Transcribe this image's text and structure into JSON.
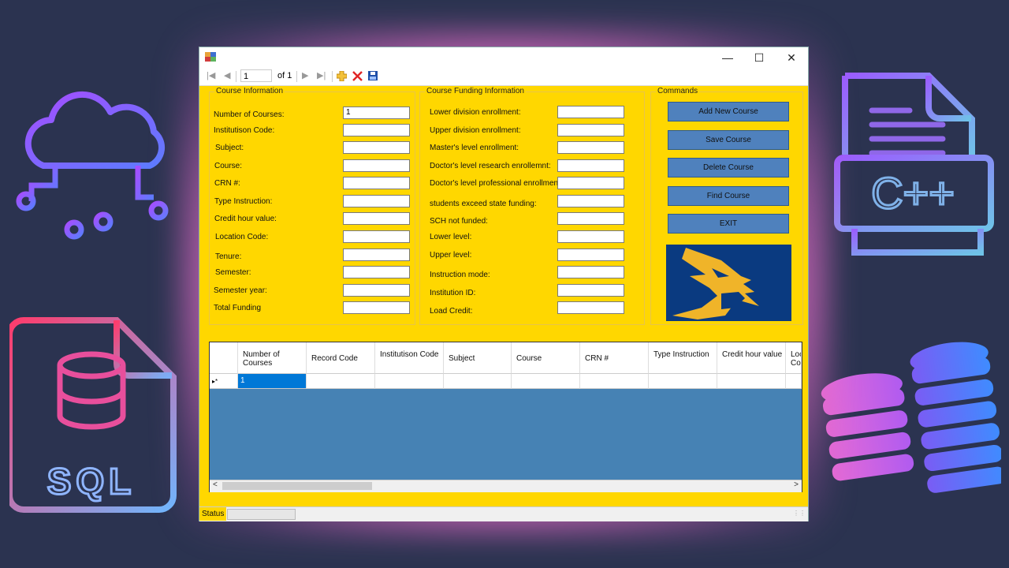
{
  "toolbar": {
    "position": "1",
    "of_text": "of 1"
  },
  "course_info": {
    "title": "Course Information",
    "fields": [
      {
        "label": "Number of Courses:",
        "value": "1"
      },
      {
        "label": "Institutison Code:",
        "value": ""
      },
      {
        "label": "Subject:",
        "value": ""
      },
      {
        "label": "Course:",
        "value": ""
      },
      {
        "label": "CRN #:",
        "value": ""
      },
      {
        "label": "Type Instruction:",
        "value": ""
      },
      {
        "label": "Credit hour value:",
        "value": ""
      },
      {
        "label": "Location Code:",
        "value": ""
      },
      {
        "label": "Tenure:",
        "value": ""
      },
      {
        "label": "Semester:",
        "value": ""
      },
      {
        "label": "Semester year:",
        "value": ""
      },
      {
        "label": "Total Funding",
        "value": ""
      }
    ]
  },
  "funding_info": {
    "title": "Course Funding Information",
    "fields": [
      {
        "label": "Lower division enrollment:",
        "value": ""
      },
      {
        "label": "Upper division enrollment:",
        "value": ""
      },
      {
        "label": "Master's level enrollment:",
        "value": ""
      },
      {
        "label": "Doctor's level research enrollemnt:",
        "value": ""
      },
      {
        "label": "Doctor's level professional enrollment:",
        "value": ""
      },
      {
        "label": "students exceed state funding:",
        "value": ""
      },
      {
        "label": "SCH not funded:",
        "value": ""
      },
      {
        "label": "Lower level:",
        "value": ""
      },
      {
        "label": "Upper level:",
        "value": ""
      },
      {
        "label": "Instruction mode:",
        "value": ""
      },
      {
        "label": "Institution ID:",
        "value": ""
      },
      {
        "label": "Load Credit:",
        "value": ""
      }
    ]
  },
  "commands": {
    "title": "Commands",
    "buttons": [
      "Add New Course",
      "Save Course",
      "Delete Course",
      "Find Course",
      "EXIT"
    ]
  },
  "grid": {
    "columns": [
      "Number of Courses",
      "Record Code",
      "Institutison Code",
      "Subject",
      "Course",
      "CRN #",
      "Type Instruction",
      "Credit hour value",
      "Location Code"
    ],
    "row_marker": "▸*",
    "rows": [
      [
        "1",
        "",
        "",
        "",
        "",
        "",
        "",
        "",
        ""
      ]
    ]
  },
  "status": {
    "label": "Status"
  },
  "colors": {
    "form_bg": "#ffd700",
    "button": "#4f81bd",
    "grid_bg": "#4682b4",
    "selected_cell": "#0078d7"
  },
  "icons": [
    "cloud-network-icon",
    "cpp-file-icon",
    "sql-file-icon",
    "database-stack-icon"
  ]
}
